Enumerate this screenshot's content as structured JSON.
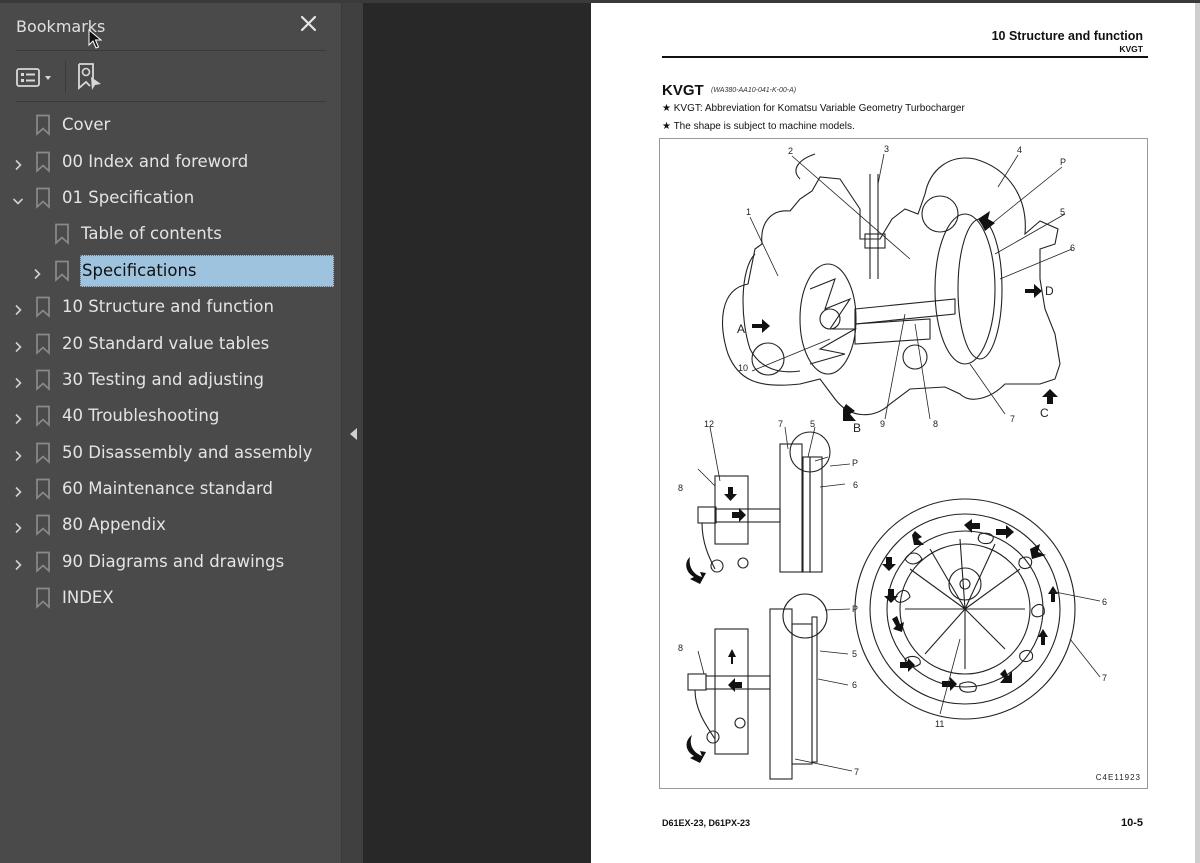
{
  "sidebar": {
    "title": "Bookmarks",
    "close_icon": "close-icon",
    "options_icon": "bookmark-options-icon",
    "find_icon": "find-current-bookmark-icon",
    "selection_color": "#9ec3de",
    "items": [
      {
        "label": "Cover",
        "level": 0,
        "expandable": false,
        "expanded": false,
        "selected": false
      },
      {
        "label": "00 Index and foreword",
        "level": 0,
        "expandable": true,
        "expanded": false,
        "selected": false
      },
      {
        "label": "01 Specification",
        "level": 0,
        "expandable": true,
        "expanded": true,
        "selected": false
      },
      {
        "label": "Table of contents",
        "level": 1,
        "expandable": false,
        "expanded": false,
        "selected": false
      },
      {
        "label": "Specifications",
        "level": 1,
        "expandable": true,
        "expanded": false,
        "selected": true
      },
      {
        "label": "10 Structure and function",
        "level": 0,
        "expandable": true,
        "expanded": false,
        "selected": false
      },
      {
        "label": "20 Standard value tables",
        "level": 0,
        "expandable": true,
        "expanded": false,
        "selected": false
      },
      {
        "label": "30 Testing and adjusting",
        "level": 0,
        "expandable": true,
        "expanded": false,
        "selected": false
      },
      {
        "label": "40 Troubleshooting",
        "level": 0,
        "expandable": true,
        "expanded": false,
        "selected": false
      },
      {
        "label": "50 Disassembly and assembly",
        "level": 0,
        "expandable": true,
        "expanded": false,
        "selected": false
      },
      {
        "label": "60 Maintenance standard",
        "level": 0,
        "expandable": true,
        "expanded": false,
        "selected": false
      },
      {
        "label": "80 Appendix",
        "level": 0,
        "expandable": true,
        "expanded": false,
        "selected": false
      },
      {
        "label": "90 Diagrams and drawings",
        "level": 0,
        "expandable": true,
        "expanded": false,
        "selected": false
      },
      {
        "label": "INDEX",
        "level": 0,
        "expandable": false,
        "expanded": false,
        "selected": false
      }
    ]
  },
  "rail": {
    "collapse_icon": "collapse-panel-icon"
  },
  "page": {
    "header_title": "10 Structure and function",
    "header_sub": "KVGT",
    "title": "KVGT",
    "doc_code": "(WA380-AA10-041-K-00-A)",
    "notes": [
      "★  KVGT: Abbreviation for Komatsu Variable Geometry Turbocharger",
      "★  The shape is subject to machine models."
    ],
    "figure": {
      "code": "C4E11923",
      "labels": {
        "n1": "1",
        "n2": "2",
        "n3": "3",
        "n4": "4",
        "n5": "5",
        "n6": "6",
        "n7": "7",
        "n8": "8",
        "n9": "9",
        "n10": "10",
        "n11": "11",
        "n12": "12",
        "A": "A",
        "B": "B",
        "C": "C",
        "D": "D",
        "P": "P"
      }
    },
    "footer_models": "D61EX-23, D61PX-23",
    "footer_page": "10-5"
  }
}
